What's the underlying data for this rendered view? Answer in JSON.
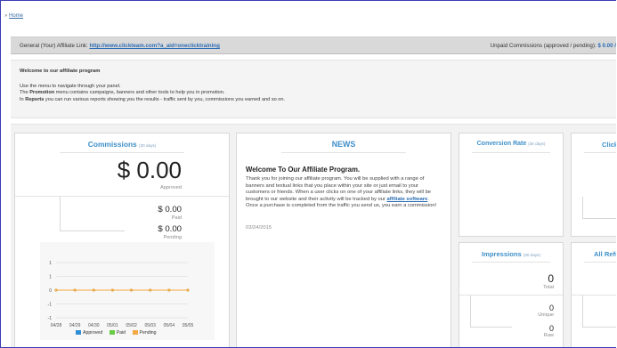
{
  "breadcrumb": {
    "home": "Home",
    "sep": "»"
  },
  "linkbar": {
    "label": "General (Your) Affiliate Link:",
    "url": "http://www.clickteam.com?a_aid=oneclicktraining",
    "unpaid_label": "Unpaid Commissions (approved / pending):",
    "unpaid_value": "$ 0.00 /"
  },
  "welcome": {
    "title": "Welcome to our affiliate program",
    "line1": "Use the menu to navigate through your panel.",
    "line2_pre": "The ",
    "line2_bold": "Promotion",
    "line2_post": " menu contains campaigns, banners and other tools to help you in promotion.",
    "line3_pre": "In ",
    "line3_bold": "Reports",
    "line3_post": " you can run various reports showing you the results - traffic sent by you, commissions you earned and so on."
  },
  "commissions": {
    "title": "Commissions",
    "period": "(30 days)",
    "approved_value": "$ 0.00",
    "approved_label": "Approved",
    "paid_value": "$ 0.00",
    "paid_label": "Paid",
    "pending_value": "$ 0.00",
    "pending_label": "Pending"
  },
  "news": {
    "title": "NEWS",
    "heading": "Welcome To Our Affiliate Program.",
    "body_pre": "Thank you for joining our affiliate program. You will be supplied with a range of banners and textual links that you place within your site or just email to your customers or friends. When a user clicks on one of your affiliate links, they will be brought to our website and their activity will be tracked by our ",
    "body_link": "affiliate software",
    "body_post": ". Once a purchase is completed from the traffic you send us, you earn a commission!",
    "date": "03/24/2015"
  },
  "conversion": {
    "title": "Conversion Rate",
    "period": "(30 days)"
  },
  "clicks": {
    "title": "Click"
  },
  "impressions": {
    "title": "Impressions",
    "period": "(30 days)",
    "total_value": "0",
    "total_label": "Total",
    "unique_value": "0",
    "unique_label": "Unique",
    "raw_value": "0",
    "raw_label": "Raw"
  },
  "refunds": {
    "title": "All Refu"
  },
  "chart_data": {
    "type": "line",
    "categories": [
      "04/28",
      "04/29",
      "04/30",
      "05/01",
      "05/02",
      "05/03",
      "05/04",
      "05/05"
    ],
    "series": [
      {
        "name": "Approved",
        "values": [
          0,
          0,
          0,
          0,
          0,
          0,
          0,
          0
        ],
        "color": "#2f8fd6"
      },
      {
        "name": "Paid",
        "values": [
          0,
          0,
          0,
          0,
          0,
          0,
          0,
          0
        ],
        "color": "#66cc44"
      },
      {
        "name": "Pending",
        "values": [
          0,
          0,
          0,
          0,
          0,
          0,
          0,
          0
        ],
        "color": "#f4a742"
      }
    ],
    "yticks": [
      "1",
      "1",
      "0",
      "-1",
      "-1"
    ],
    "ylim": [
      -1,
      1
    ],
    "title": "",
    "xlabel": "",
    "ylabel": ""
  }
}
